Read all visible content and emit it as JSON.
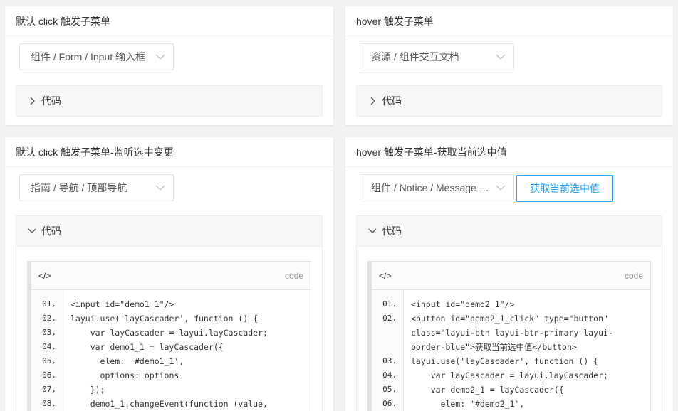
{
  "cards": [
    {
      "title": "默认 click 触发子菜单",
      "select_value": "组件 / Form / Input 输入框",
      "collapse_label": "代码"
    },
    {
      "title": "hover 触发子菜单",
      "select_value": "资源 / 组件交互文档",
      "collapse_label": "代码"
    },
    {
      "title": "默认 click 触发子菜单-监听选中变更",
      "select_value": "指南 / 导航 / 顶部导航",
      "collapse_label": "代码",
      "code_head": "</>",
      "code_lang": "code",
      "line_numbers": [
        "01.",
        "02.",
        "03.",
        "04.",
        "05.",
        "06.",
        "07.",
        "08."
      ],
      "code_lines": [
        "<input id=\"demo1_1\"/>",
        "layui.use('layCascader', function () {",
        "    var layCascader = layui.layCascader;",
        "    var demo1_1 = layCascader({",
        "      elem: '#demo1_1',",
        "      options: options",
        "    });",
        "    demo1_1.changeEvent(function (value,"
      ]
    },
    {
      "title": "hover 触发子菜单-获取当前选中值",
      "select_value": "组件 / Notice / Message 全局提示",
      "button_label": "获取当前选中值",
      "collapse_label": "代码",
      "code_head": "</>",
      "code_lang": "code",
      "line_numbers": [
        "01.",
        "02.",
        "",
        "",
        "03.",
        "04.",
        "05.",
        "06."
      ],
      "code_lines": [
        "<input id=\"demo2_1\"/>",
        "<button id=\"demo2_1_click\" type=\"button\"",
        "class=\"layui-btn layui-btn-primary layui-",
        "border-blue\">获取当前选中值</button>",
        "layui.use('layCascader', function () {",
        "    var layCascader = layui.layCascader;",
        "    var demo2_1 = layCascader({",
        "      elem: '#demo2_1',"
      ]
    }
  ],
  "icons": {
    "caret": "chevron-down-icon",
    "collapsed_arrow": "chevron-right-icon",
    "expanded_arrow": "chevron-down-icon"
  }
}
